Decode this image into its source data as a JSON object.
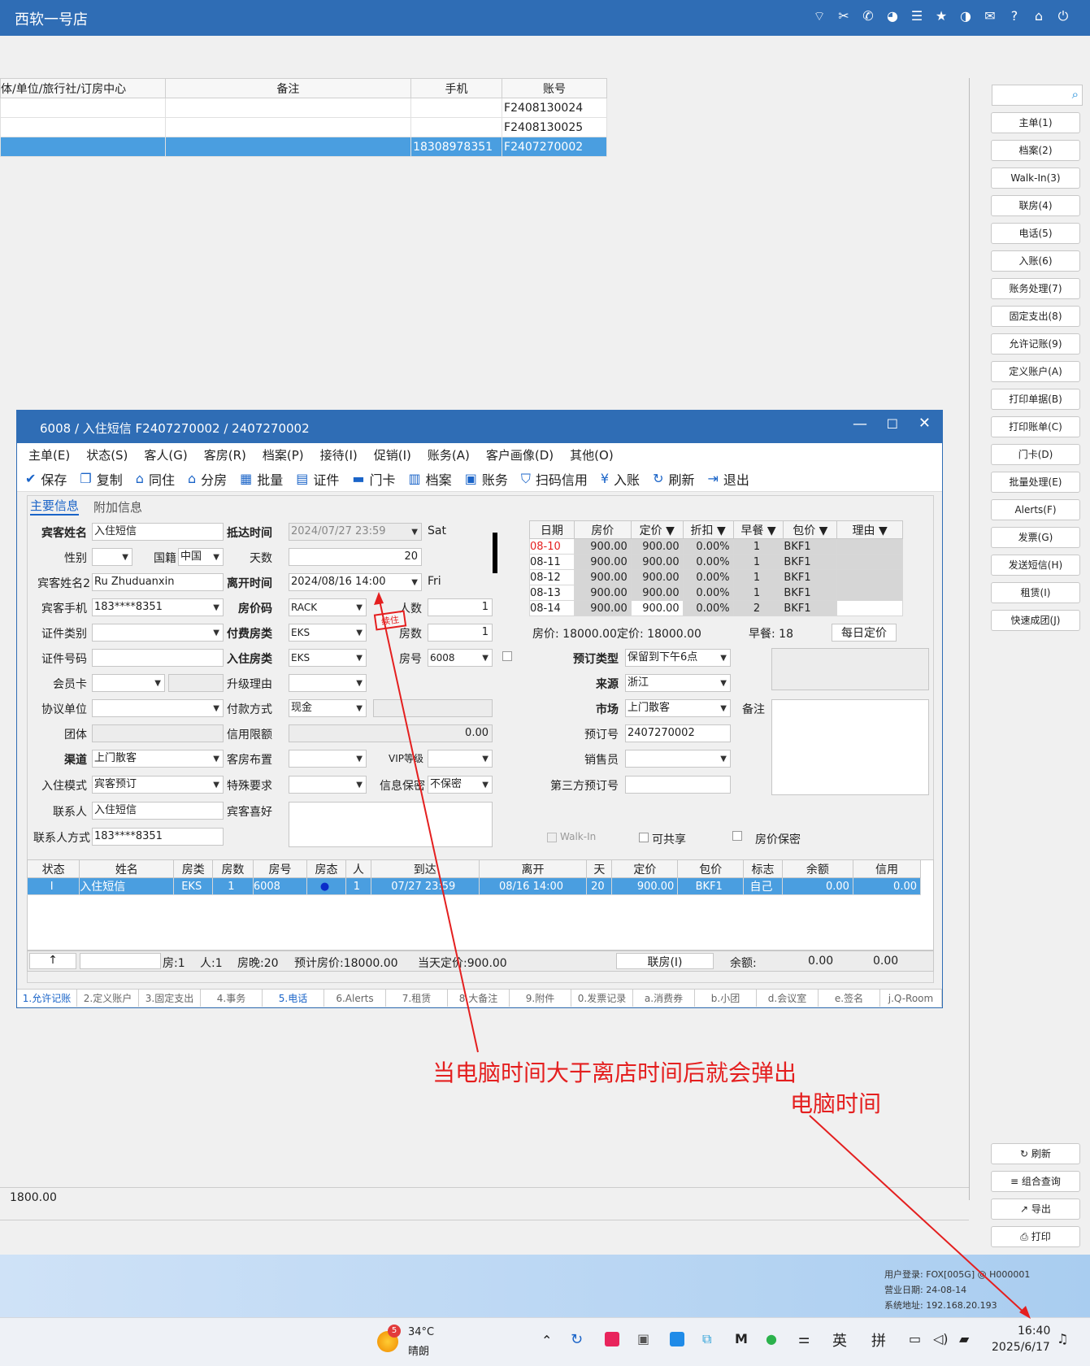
{
  "app": {
    "title": "西软一号店",
    "topicons": [
      "wifi-icon",
      "tools-icon",
      "phone-icon",
      "palette-icon",
      "menu-icon",
      "star-icon",
      "theme-icon",
      "mail-icon",
      "help-icon",
      "home-icon",
      "power-icon"
    ]
  },
  "bg_table": {
    "headers": [
      "体/单位/旅行社/订房中心",
      "备注",
      "手机",
      "账号"
    ],
    "rows": [
      [
        "",
        "",
        "",
        "F2408130024"
      ],
      [
        "",
        "",
        "",
        "F2408130025"
      ],
      [
        "",
        "",
        "18308978351",
        "F2407270002"
      ]
    ],
    "footer_value": "1800.00"
  },
  "sidebar": {
    "buttons": [
      "主单(1)",
      "档案(2)",
      "Walk-In(3)",
      "联房(4)",
      "电话(5)",
      "入账(6)",
      "账务处理(7)",
      "固定支出(8)",
      "允许记账(9)",
      "定义账户(A)",
      "打印单据(B)",
      "打印账单(C)",
      "门卡(D)",
      "批量处理(E)",
      "Alerts(F)",
      "发票(G)",
      "发送短信(H)",
      "租赁(I)",
      "快速成团(J)"
    ],
    "bottom_buttons": [
      "刷新",
      "组合查询",
      "导出",
      "打印"
    ]
  },
  "status_info": {
    "user": "用户登录: FOX[005G] @ H000001",
    "bizdate": "营业日期: 24-08-14",
    "address": "系统地址: 192.168.20.193"
  },
  "taskbar": {
    "weather_badge": "5",
    "temp": "34°C",
    "weather": "晴朗",
    "ime1": "英",
    "ime2": "拼",
    "time": "16:40",
    "date": "2025/6/17"
  },
  "window": {
    "title": "6008 / 入住短信 F2407270002 / 2407270002",
    "menu": [
      "主单(E)",
      "状态(S)",
      "客人(G)",
      "客房(R)",
      "档案(P)",
      "接待(I)",
      "促销(I)",
      "账务(A)",
      "客户画像(D)",
      "其他(O)"
    ],
    "toolbar": [
      "保存",
      "复制",
      "同住",
      "分房",
      "批量",
      "证件",
      "门卡",
      "档案",
      "账务",
      "扫码信用",
      "入账",
      "刷新",
      "退出"
    ],
    "subtabs": [
      "主要信息",
      "附加信息"
    ],
    "form": {
      "guest_name_label": "宾客姓名",
      "guest_name": "入住短信",
      "gender_label": "性别",
      "nation_label": "国籍",
      "nation": "中国",
      "guest_name2_label": "宾客姓名2",
      "guest_name2": "Ru Zhuduanxin",
      "mobile_label": "宾客手机",
      "mobile": "183****8351",
      "idtype_label": "证件类别",
      "idno_label": "证件号码",
      "member_label": "会员卡",
      "agreement_label": "协议单位",
      "group_label": "团体",
      "channel_label": "渠道",
      "channel": "上门散客",
      "checkin_mode_label": "入住模式",
      "checkin_mode": "宾客预订",
      "contact_label": "联系人",
      "contact": "入住短信",
      "contact_way_label": "联系人方式",
      "contact_way": "183****8351",
      "arrive_label": "抵达时间",
      "arrive": "2024/07/27 23:59",
      "arrive_day": "Sat",
      "days_label": "天数",
      "days": "20",
      "leave_label": "离开时间",
      "leave": "2024/08/16 14:00",
      "leave_day": "Fri",
      "ratecode_label": "房价码",
      "ratecode": "RACK",
      "persons_label": "人数",
      "persons": "1",
      "paytype_label": "付费房类",
      "paytype": "EKS",
      "rooms_label": "房数",
      "rooms": "1",
      "roomtype_label": "入住房类",
      "roomtype": "EKS",
      "roomno_label": "房号",
      "roomno": "6008",
      "upgrade_label": "升级理由",
      "payway_label": "付款方式",
      "payway": "现金",
      "credit_label": "信用限额",
      "credit": "0.00",
      "layout_label": "客房布置",
      "vip_label": "VIP等级",
      "special_label": "特殊要求",
      "secret_label": "信息保密",
      "secret": "不保密",
      "pref_label": "宾客喜好",
      "stamp": "续住",
      "booktype_label": "预订类型",
      "booktype": "保留到下午6点",
      "source_label": "来源",
      "source": "浙江",
      "market_label": "市场",
      "market": "上门散客",
      "bookno_label": "预订号",
      "bookno": "2407270002",
      "sales_label": "销售员",
      "thirdno_label": "第三方预订号",
      "remark_label": "备注",
      "walkin": "Walk-In",
      "shareable": "可共享",
      "rate_secret": "房价保密"
    },
    "rate_grid": {
      "headers": [
        "日期",
        "房价",
        "定价",
        "折扣",
        "早餐",
        "包价",
        "理由"
      ],
      "rows": [
        [
          "08-10",
          "900.00",
          "900.00",
          "0.00%",
          "1",
          "BKF1",
          ""
        ],
        [
          "08-11",
          "900.00",
          "900.00",
          "0.00%",
          "1",
          "BKF1",
          ""
        ],
        [
          "08-12",
          "900.00",
          "900.00",
          "0.00%",
          "1",
          "BKF1",
          ""
        ],
        [
          "08-13",
          "900.00",
          "900.00",
          "0.00%",
          "1",
          "BKF1",
          ""
        ],
        [
          "08-14",
          "900.00",
          "900.00",
          "0.00%",
          "2",
          "BKF1",
          ""
        ]
      ],
      "summary_rate": "房价: 18000.00",
      "summary_price": "定价: 18000.00",
      "breakfast": "早餐: 18",
      "daily_btn": "每日定价"
    },
    "guest_grid": {
      "headers": [
        "状态",
        "姓名",
        "房类",
        "房数",
        "房号",
        "房态",
        "人",
        "到达",
        "离开",
        "天",
        "定价",
        "包价",
        "标志",
        "余额",
        "信用"
      ],
      "rows": [
        [
          "I",
          "入住短信",
          "EKS",
          "1",
          "6008",
          "●",
          "1",
          "07/27 23:59",
          "08/16 14:00",
          "20",
          "900.00",
          "BKF1",
          "自己",
          "0.00",
          "0.00"
        ]
      ]
    },
    "footer": {
      "up": "↑",
      "text1": "房:1",
      "text2": "人:1",
      "text3": "房晚:20",
      "text4": "预计房价:18000.00",
      "text5": "当天定价:900.00",
      "join_btn": "联房(I)",
      "balance_label": "余额:",
      "balance": "0.00",
      "credit": "0.00"
    },
    "bottom_tabs": [
      "1.允许记账",
      "2.定义账户",
      "3.固定支出",
      "4.事务",
      "5.电话",
      "6.Alerts",
      "7.租赁",
      "8.大备注",
      "9.附件",
      "0.发票记录",
      "a.消费券",
      "b.小团",
      "d.会议室",
      "e.签名",
      "j.Q-Room"
    ]
  },
  "annotation": {
    "line1": "当电脑时间大于离店时间后就会弹出",
    "line2": "电脑时间"
  }
}
